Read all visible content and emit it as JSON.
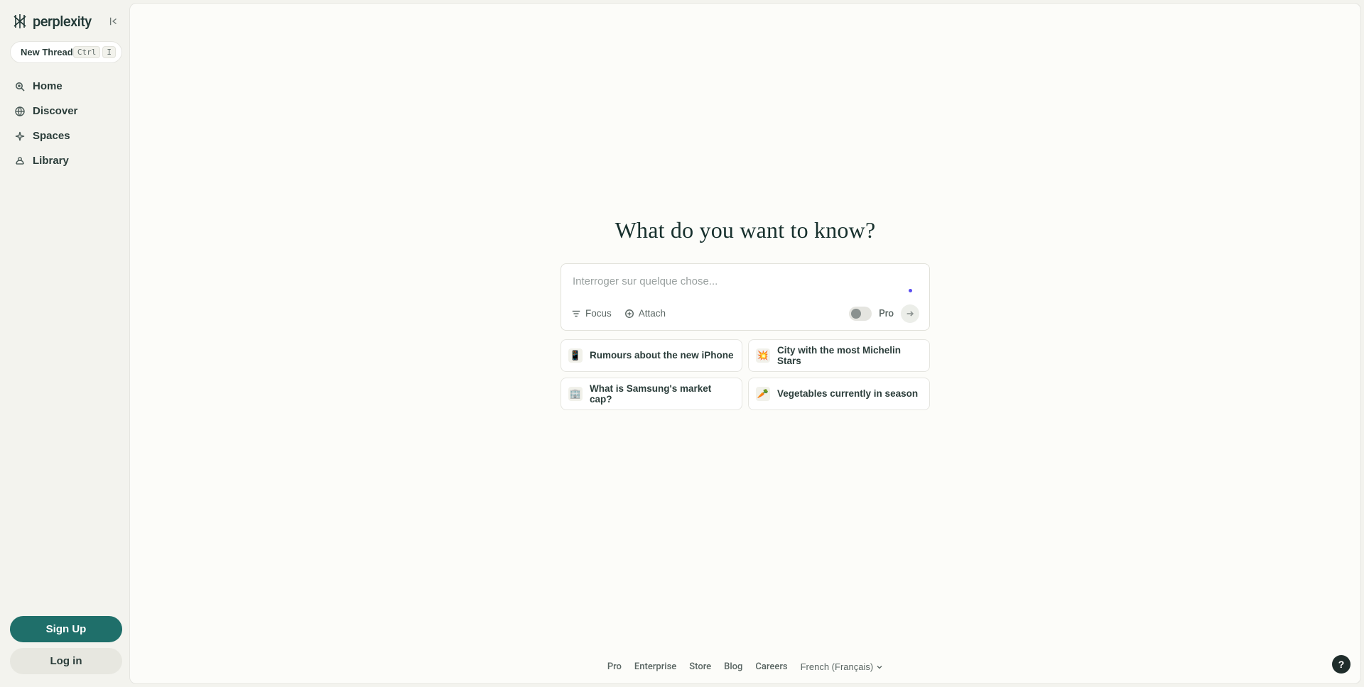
{
  "brand": {
    "name": "perplexity"
  },
  "sidebar": {
    "new_thread_label": "New Thread",
    "kbd_ctrl": "Ctrl",
    "kbd_i": "I",
    "items": [
      {
        "label": "Home"
      },
      {
        "label": "Discover"
      },
      {
        "label": "Spaces"
      },
      {
        "label": "Library"
      }
    ],
    "signup_label": "Sign Up",
    "login_label": "Log in"
  },
  "hero": {
    "title": "What do you want to know?",
    "placeholder": "Interroger sur quelque chose...",
    "focus_label": "Focus",
    "attach_label": "Attach",
    "pro_label": "Pro"
  },
  "suggestions": [
    {
      "emoji": "📱",
      "text": "Rumours about the new iPhone"
    },
    {
      "emoji": "💥",
      "text": "City with the most Michelin Stars"
    },
    {
      "emoji": "🏢",
      "text": "What is Samsung's market cap?"
    },
    {
      "emoji": "🥕",
      "text": "Vegetables currently in season"
    }
  ],
  "footer": {
    "links": [
      "Pro",
      "Enterprise",
      "Store",
      "Blog",
      "Careers"
    ],
    "language": "French (Français)"
  },
  "help": {
    "glyph": "?"
  }
}
